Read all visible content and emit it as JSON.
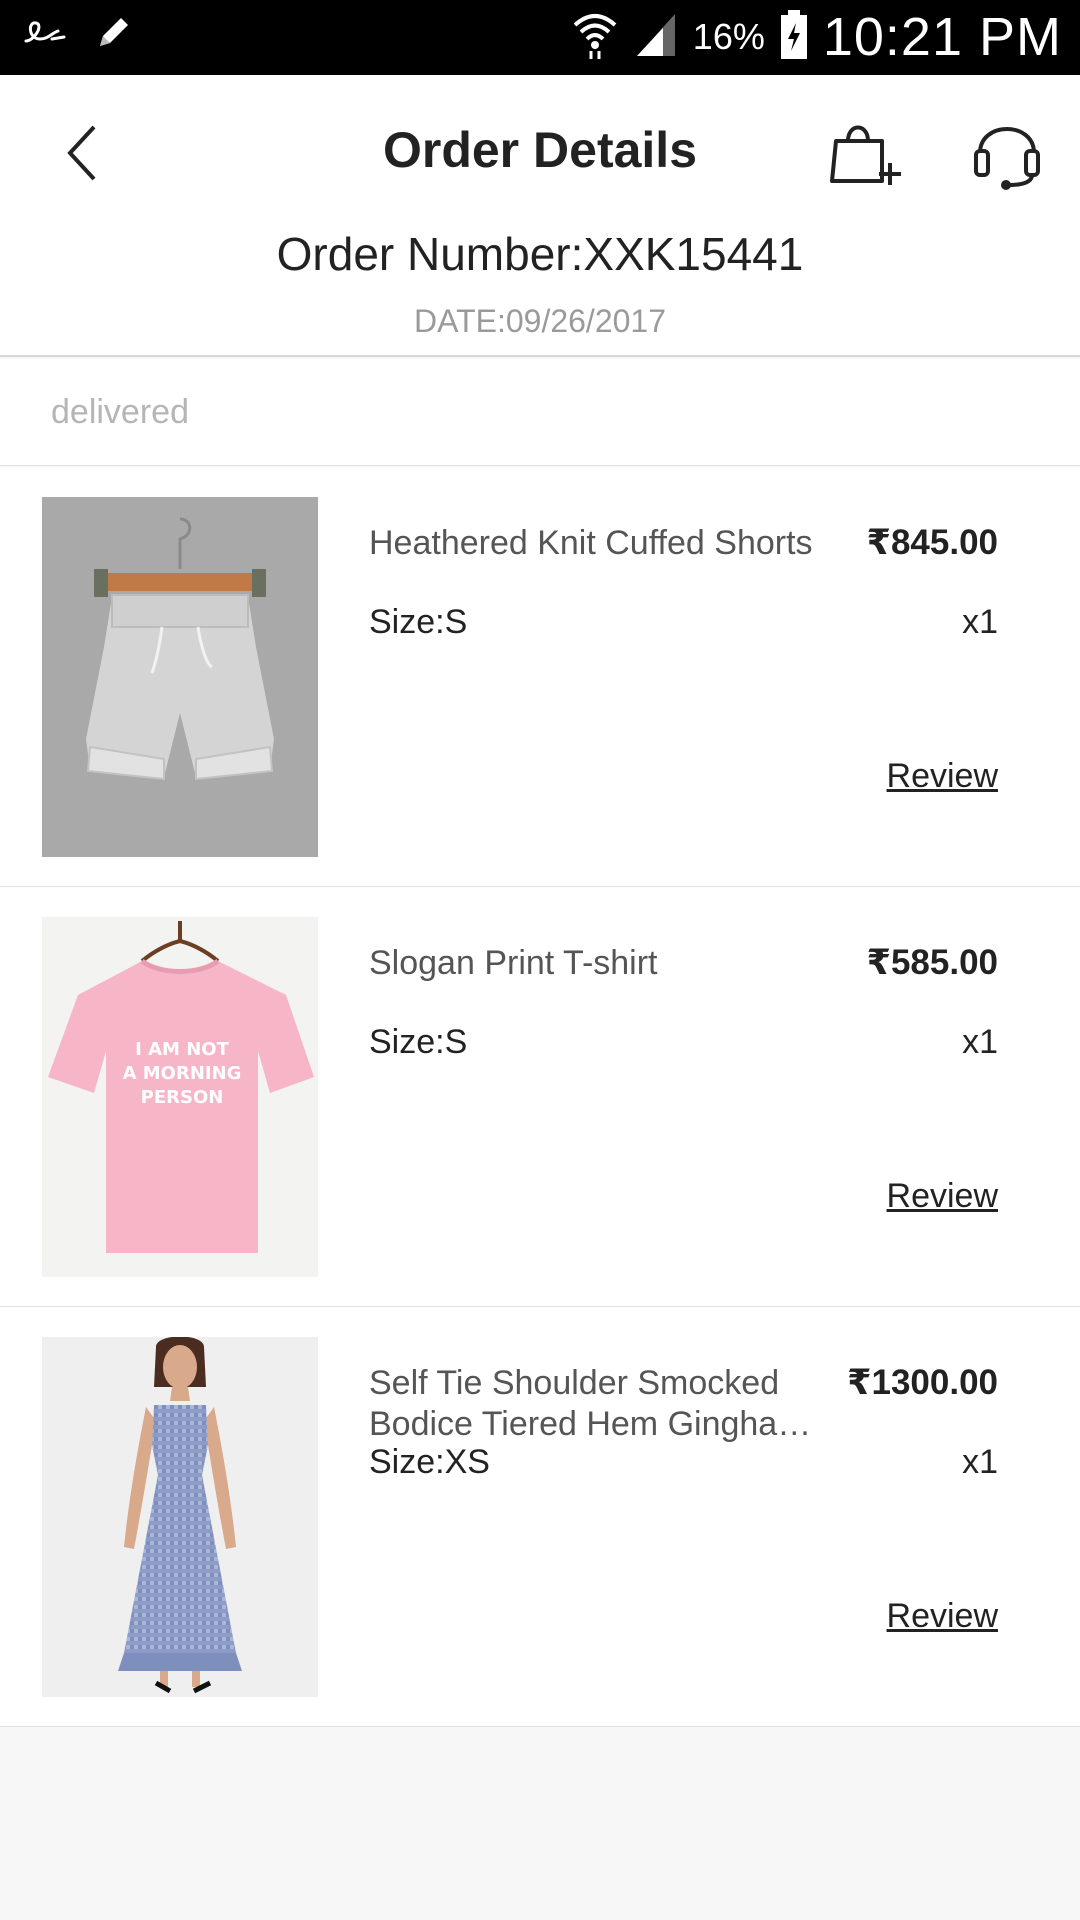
{
  "status_bar": {
    "battery_percent": "16%",
    "time": "10:21 PM",
    "icons": [
      "script-e-icon",
      "pencil-icon",
      "wifi-icon",
      "signal-icon",
      "battery-icon"
    ]
  },
  "header": {
    "title": "Order Details",
    "order_number": "Order Number:XXK15441",
    "date": "DATE:09/26/2017",
    "icons": {
      "back": "back-chevron-icon",
      "bag": "bag-add-icon",
      "support": "headset-icon"
    }
  },
  "order_status": "delivered",
  "items": [
    {
      "name": "Heathered Knit Cuffed Shorts",
      "price": "₹845.00",
      "size": "Size:S",
      "qty": "x1",
      "review": "Review",
      "image": "grey-shorts-image"
    },
    {
      "name": "Slogan Print T-shirt",
      "price": "₹585.00",
      "size": "Size:S",
      "qty": "x1",
      "review": "Review",
      "image": "pink-tshirt-image",
      "shirt_text": [
        "I AM NOT",
        "A MORNING",
        "PERSON"
      ]
    },
    {
      "name": "Self Tie Shoulder Smocked Bodice Tiered Hem Gingha…",
      "price": "₹1300.00",
      "size": "Size:XS",
      "qty": "x1",
      "review": "Review",
      "image": "gingham-dress-image"
    }
  ],
  "colors": {
    "status_bar_bg": "#000000",
    "page_bg": "#f7f7f7",
    "muted_text": "#9a9a9a",
    "status_text": "#b5b5b5"
  }
}
